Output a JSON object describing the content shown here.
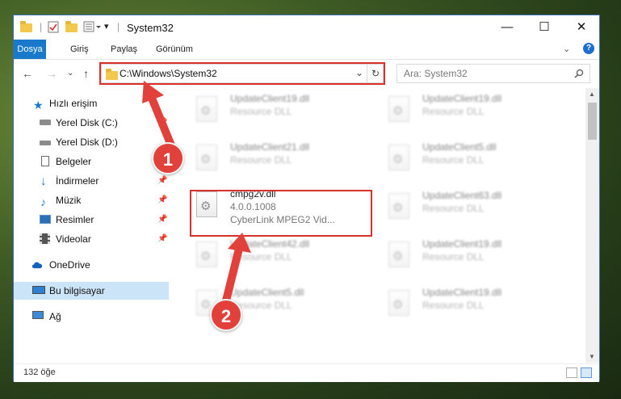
{
  "window": {
    "title": "System32",
    "controls": {
      "minimize": "—",
      "maximize": "☐",
      "close": "✕"
    }
  },
  "ribbon": {
    "tabs": [
      {
        "label": "Dosya"
      },
      {
        "label": "Giriş"
      },
      {
        "label": "Paylaş"
      },
      {
        "label": "Görünüm"
      }
    ],
    "help": "?"
  },
  "navigation": {
    "address": "C:\\Windows\\System32",
    "search_placeholder": "Ara: System32"
  },
  "sidebar": {
    "items": [
      {
        "label": "Hızlı erişim",
        "icon": "star-icon"
      },
      {
        "label": "Yerel Disk (C:)",
        "icon": "drive-icon",
        "pinned": true
      },
      {
        "label": "Yerel Disk (D:)",
        "icon": "drive-icon"
      },
      {
        "label": "Belgeler",
        "icon": "document-icon",
        "pinned": true
      },
      {
        "label": "İndirmeler",
        "icon": "download-arrow-icon",
        "pinned": true
      },
      {
        "label": "Müzik",
        "icon": "music-icon",
        "pinned": true
      },
      {
        "label": "Resimler",
        "icon": "pictures-icon",
        "pinned": true
      },
      {
        "label": "Videolar",
        "icon": "video-icon",
        "pinned": true
      },
      {
        "label": "OneDrive",
        "icon": "cloud-icon"
      },
      {
        "label": "Bu bilgisayar",
        "icon": "computer-icon",
        "selected": true
      },
      {
        "label": "Ağ",
        "icon": "network-icon"
      }
    ]
  },
  "files": [
    {
      "name": "UpdateClient19.dll",
      "type": "Resource DLL"
    },
    {
      "name": "UpdateClient19.dll",
      "type": "Resource DLL"
    },
    {
      "name": "UpdateClient21.dll",
      "type": "Resource DLL"
    },
    {
      "name": "UpdateClient5.dll",
      "type": "Resource DLL"
    },
    {
      "name": "cmpg2v.dll",
      "version": "4.0.0.1008",
      "description": "CyberLink MPEG2 Vid..."
    },
    {
      "name": "UpdateClient63.dll",
      "type": "Resource DLL"
    },
    {
      "name": "UpdateClient42.dll",
      "type": "Resource DLL"
    },
    {
      "name": "UpdateClient19.dll",
      "type": "Resource DLL"
    },
    {
      "name": "UpdateClient5.dll",
      "type": "Resource DLL"
    },
    {
      "name": "UpdateClient19.dll",
      "type": "Resource DLL"
    }
  ],
  "status": {
    "item_count": "132 öğe"
  },
  "annotations": {
    "step1": "1",
    "step2": "2"
  },
  "colors": {
    "accent": "#1979ca",
    "highlight": "#d9302c",
    "selected": "#cce4f7"
  }
}
